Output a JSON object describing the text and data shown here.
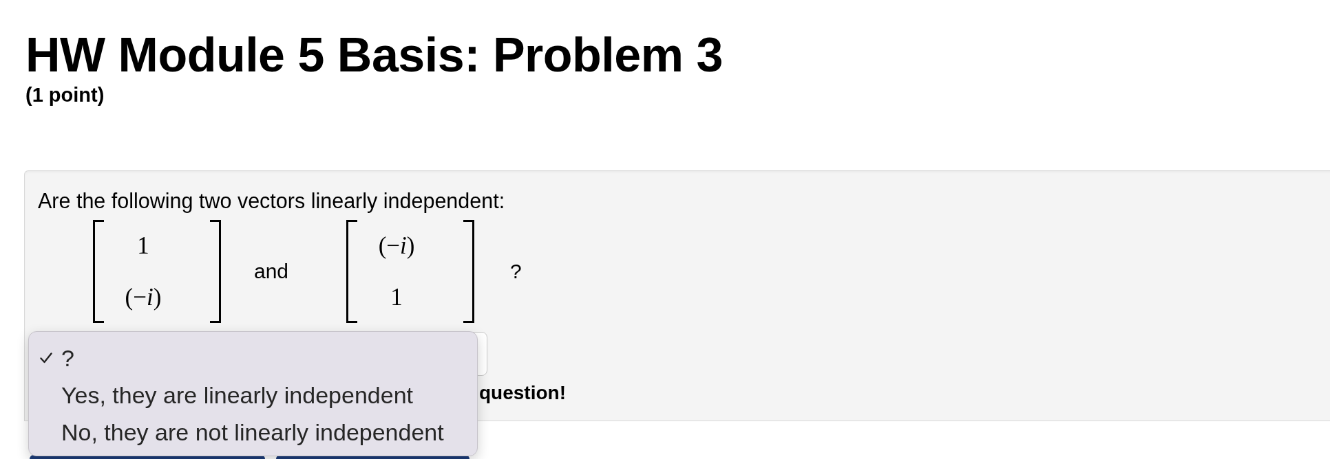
{
  "title": "HW Module 5 Basis: Problem 3",
  "points": "(1 point)",
  "question": {
    "prompt": "Are the following two vectors linearly independent:",
    "vectors": [
      {
        "entries": [
          "1",
          "(−*i*)"
        ]
      },
      {
        "entries": [
          "(−*i*)",
          "1"
        ]
      }
    ],
    "conjunction": "and",
    "end_mark": "?"
  },
  "answer_menu": {
    "expanded": true,
    "options": [
      {
        "label": "?",
        "selected": true
      },
      {
        "label": "Yes, they are linearly independent",
        "selected": false
      },
      {
        "label": "No, they are not linearly independent",
        "selected": false
      }
    ]
  },
  "notice": "question!",
  "buttons": [
    {
      "kind": "primary"
    },
    {
      "kind": "primary"
    }
  ]
}
